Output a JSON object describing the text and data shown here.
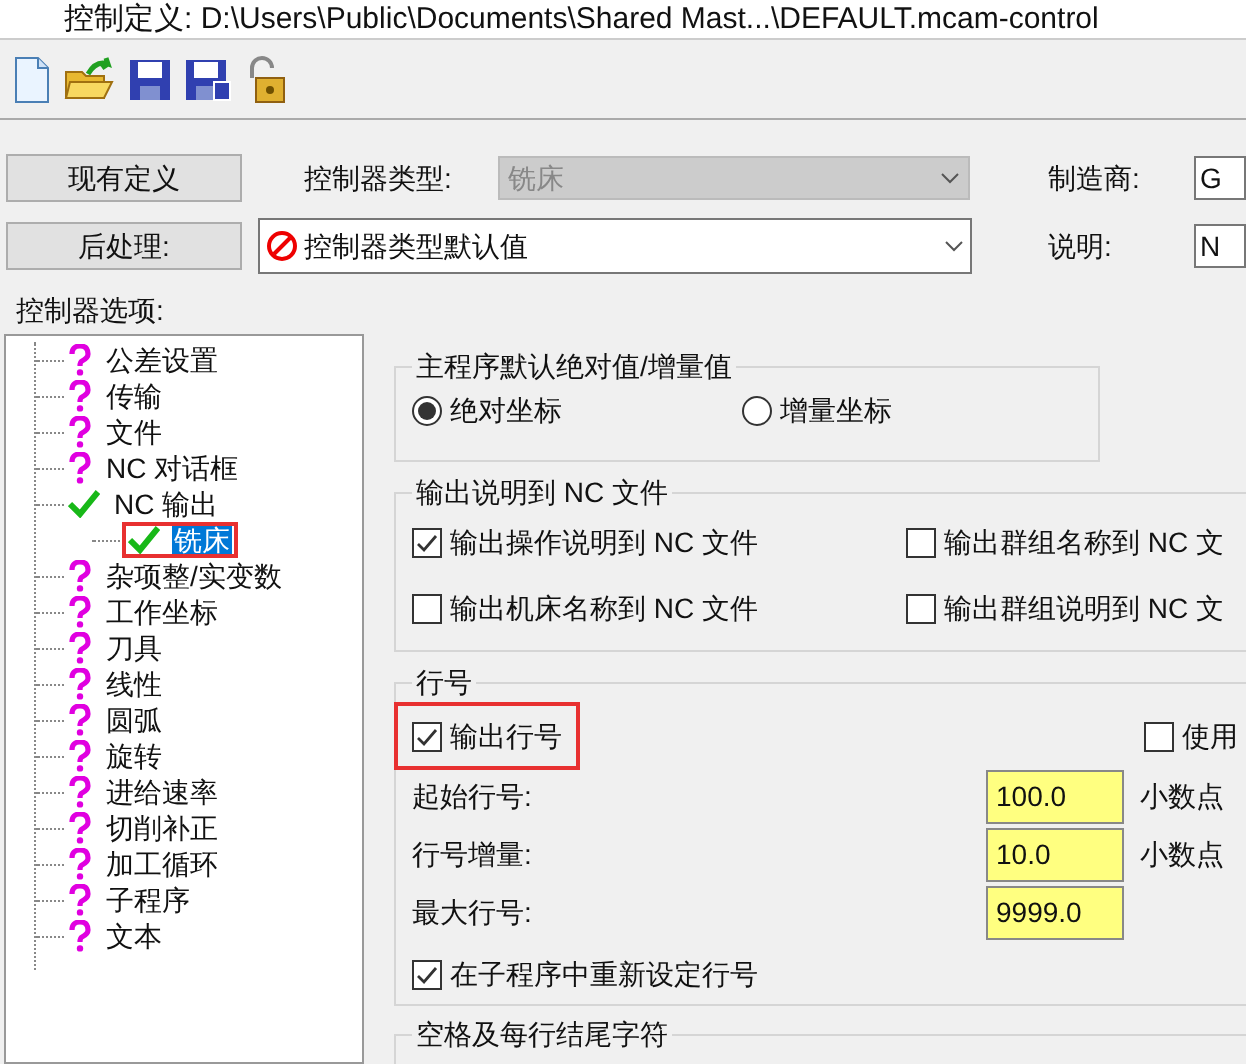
{
  "window": {
    "title": "控制定义: D:\\Users\\Public\\Documents\\Shared Mast...\\DEFAULT.mcam-control"
  },
  "existing_button": "现有定义",
  "controller_type": {
    "label": "控制器类型:",
    "value": "铣床",
    "disabled": true
  },
  "manufacturer": {
    "label": "制造商:",
    "value": "G"
  },
  "post_button": "后处理:",
  "post": {
    "value": "控制器类型默认值"
  },
  "description": {
    "label": "说明:",
    "value": "N"
  },
  "options_label": "控制器选项:",
  "tree": [
    {
      "label": "公差设置",
      "done": false
    },
    {
      "label": "传输",
      "done": false
    },
    {
      "label": "文件",
      "done": false
    },
    {
      "label": "NC 对话框",
      "done": false
    },
    {
      "label": "NC 输出",
      "done": true,
      "children": [
        {
          "label": "铣床",
          "done": true,
          "selected": true,
          "highlighted": true
        }
      ]
    },
    {
      "label": "杂项整/实变数",
      "done": false
    },
    {
      "label": "工作坐标",
      "done": false
    },
    {
      "label": "刀具",
      "done": false
    },
    {
      "label": "线性",
      "done": false
    },
    {
      "label": "圆弧",
      "done": false
    },
    {
      "label": "旋转",
      "done": false
    },
    {
      "label": "进给速率",
      "done": false
    },
    {
      "label": "切削补正",
      "done": false
    },
    {
      "label": "加工循环",
      "done": false
    },
    {
      "label": "子程序",
      "done": false
    },
    {
      "label": "文本",
      "done": false
    }
  ],
  "main_default": {
    "title": "主程序默认绝对值/增量值",
    "options": [
      {
        "label": "绝对坐标",
        "selected": true
      },
      {
        "label": "增量坐标",
        "selected": false
      }
    ]
  },
  "output_comments": {
    "title": "输出说明到 NC 文件",
    "checkboxes": [
      {
        "label": "输出操作说明到 NC 文件",
        "checked": true
      },
      {
        "label": "输出群组名称到 NC 文",
        "checked": false
      },
      {
        "label": "输出机床名称到 NC 文件",
        "checked": false
      },
      {
        "label": "输出群组说明到 NC 文",
        "checked": false
      }
    ]
  },
  "line_numbers": {
    "title": "行号",
    "output": {
      "label": "输出行号",
      "checked": true,
      "highlighted": true
    },
    "use": {
      "label": "使用",
      "checked": false
    },
    "fields": [
      {
        "label": "起始行号:",
        "value": "100.0",
        "note": "小数点"
      },
      {
        "label": "行号增量:",
        "value": "10.0",
        "note": "小数点"
      },
      {
        "label": "最大行号:",
        "value": "9999.0"
      }
    ],
    "reset": {
      "label": "在子程序中重新设定行号",
      "checked": true
    }
  },
  "spacing": {
    "title": "空格及每行结尾字符"
  }
}
